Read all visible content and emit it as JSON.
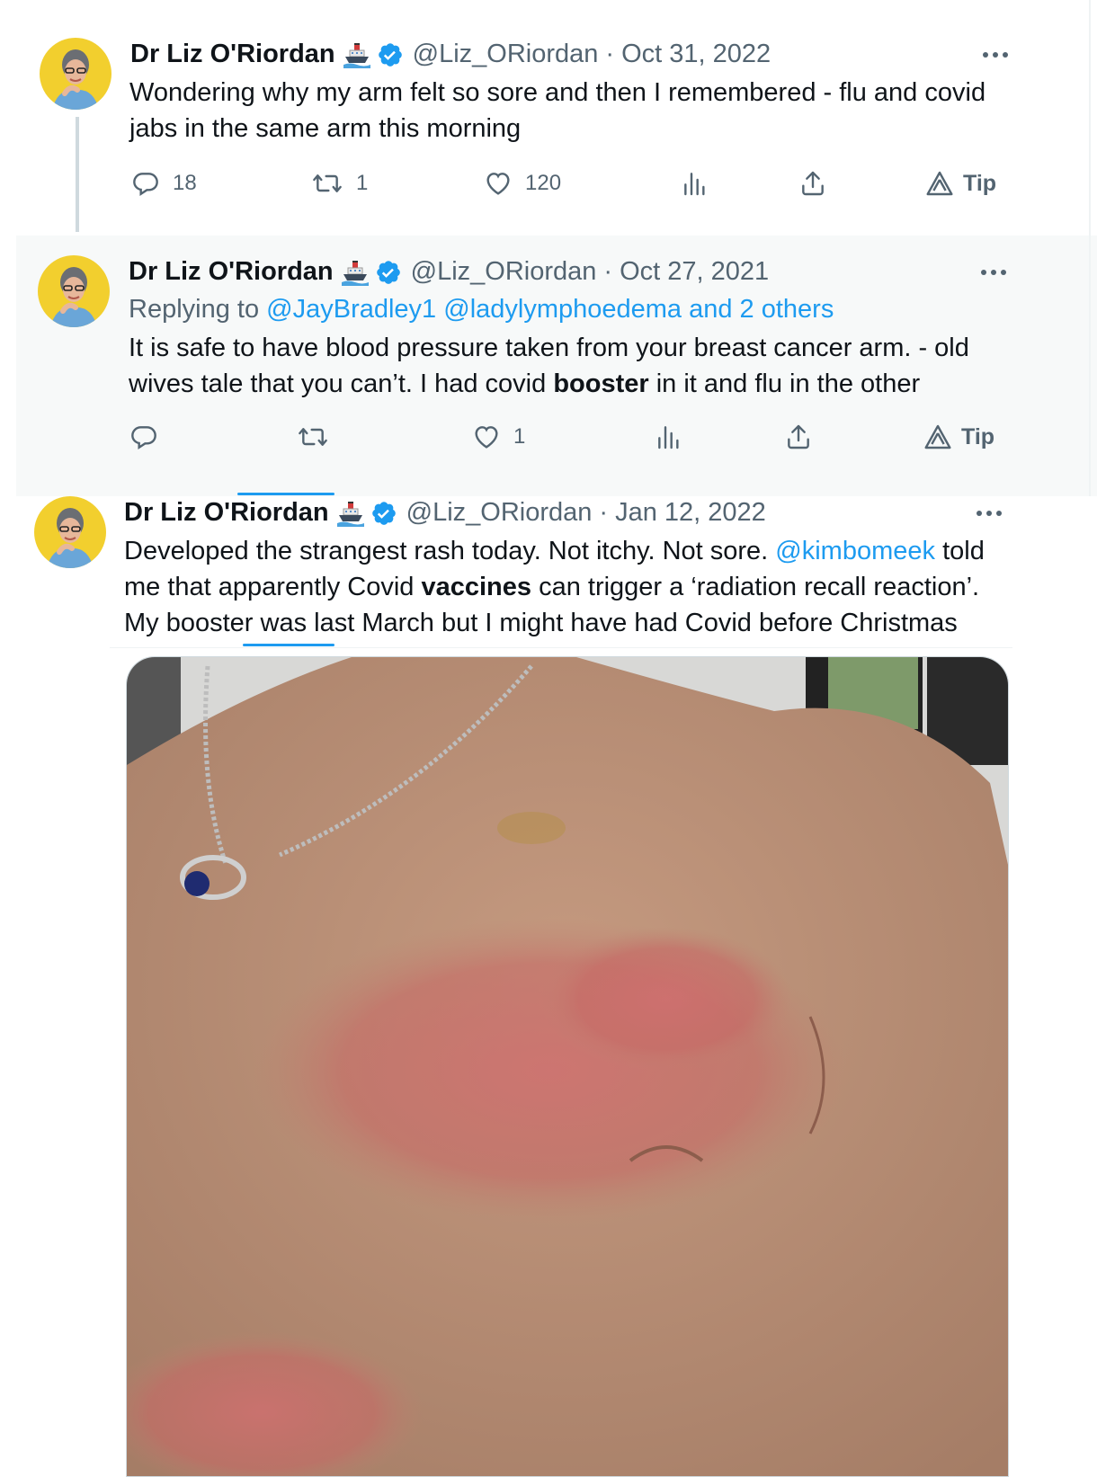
{
  "tweets": [
    {
      "author": "Dr Liz O'Riordan",
      "handle": "@Liz_ORiordan",
      "date": "Oct 31, 2022",
      "separator": "·",
      "text": "Wondering why my arm felt so sore and then I remembered - flu and covid jabs in the same arm this morning",
      "replies": "18",
      "retweets": "1",
      "likes": "120",
      "tip_label": "Tip"
    },
    {
      "author": "Dr Liz O'Riordan",
      "handle": "@Liz_ORiordan",
      "date": "Oct 27, 2021",
      "separator": "·",
      "replying_prefix": "Replying to",
      "replying_user1": "@JayBradley1",
      "replying_user2": "@ladylymphoedema",
      "replying_others": "and 2 others",
      "text_line1": "It is safe to have blood pressure taken from your breast cancer arm. - old",
      "text_line2_before": "wives tale that you can’t. I had covid ",
      "text_line2_bold": "booster",
      "text_line2_after": " in it and flu in the other",
      "likes": "1",
      "tip_label": "Tip"
    },
    {
      "author": "Dr Liz O'Riordan",
      "handle": "@Liz_ORiordan",
      "date": "Jan 12, 2022",
      "separator": "·",
      "text_line1_before": "Developed the strangest rash today. Not itchy. Not sore. ",
      "text_line1_mention": "@kimbomeek",
      "text_line1_after": " told",
      "text_line2_before": "me that apparently Covid ",
      "text_line2_bold": "vaccines",
      "text_line2_after": " can trigger a ‘radiation recall reaction’.",
      "text_line3": "My booster was last March but I might have had Covid before Christmas"
    }
  ],
  "icons": {
    "reply": "reply-icon",
    "retweet": "retweet-icon",
    "like": "heart-icon",
    "views": "views-icon",
    "share": "share-icon",
    "tip": "tip-icon",
    "ship": "ship-emoji-icon",
    "verified": "verified-badge-icon",
    "more": "more-icon"
  },
  "colors": {
    "link": "#1d9bf0",
    "verified": "#1d9bf0",
    "muted": "#536471",
    "highlight_bg": "#f7f9f9"
  }
}
